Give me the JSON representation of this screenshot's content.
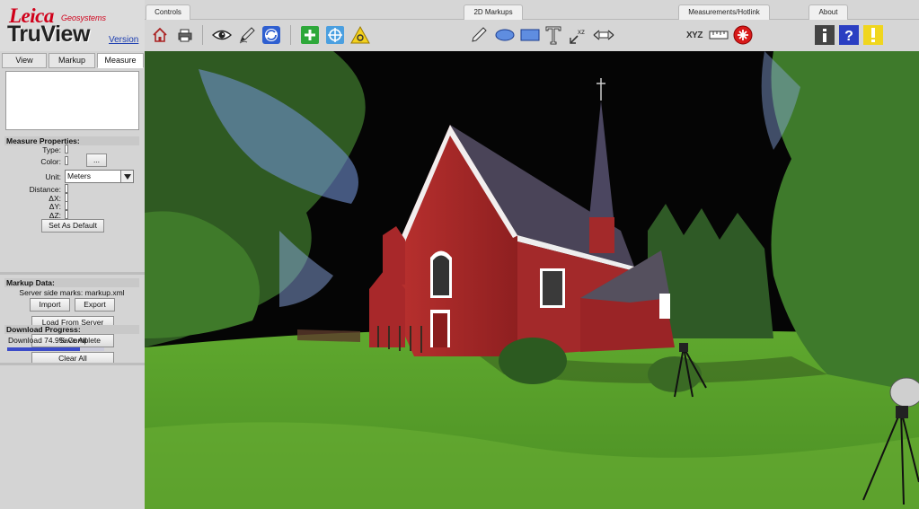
{
  "app": {
    "brand": "Leica",
    "brand_sub": "Geosystems",
    "product": "TruView",
    "version_link": "Version"
  },
  "toolbar": {
    "groups": {
      "controls": "Controls",
      "markups": "2D Markups",
      "measurements": "Measurements/Hotlink",
      "about": "About"
    },
    "xyz_label": "XYZ"
  },
  "panel": {
    "tabs": [
      "View",
      "Markup",
      "Measure"
    ],
    "active_tab": "Measure",
    "measure_properties": {
      "title": "Measure Properties:",
      "type_label": "Type:",
      "color_label": "Color:",
      "color_button": "...",
      "unit_label": "Unit:",
      "unit_value": "Meters",
      "distance_label": "Distance:",
      "dx_label": "ΔX:",
      "dy_label": "ΔY:",
      "dz_label": "ΔZ:",
      "set_default_button": "Set As Default"
    },
    "markup_data": {
      "title": "Markup Data:",
      "server_marks": "Server side marks: markup.xml",
      "import_button": "Import",
      "export_button": "Export",
      "load_button": "Load From Server"
    },
    "download": {
      "title": "Download Progress:",
      "status": "Download 74.9% Complete",
      "progress": 0.749,
      "save_button": "Save All",
      "clear_button": "Clear All"
    }
  },
  "colors": {
    "brand_red": "#d0001a",
    "link_blue": "#1a3cb0",
    "progress_blue": "#3b4bc8",
    "church_red": "#a8282a"
  }
}
